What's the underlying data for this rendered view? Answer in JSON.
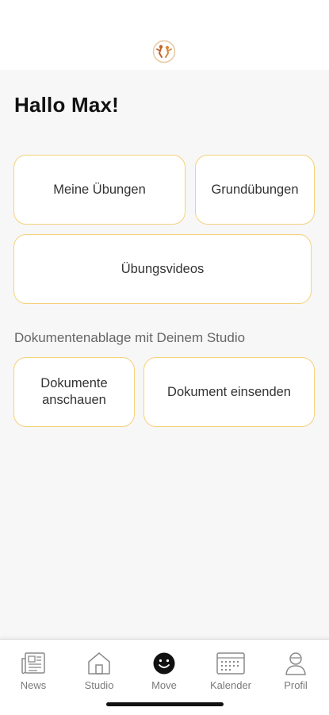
{
  "header": {
    "logo_icon": "fitness-logo-icon"
  },
  "greeting": "Hallo Max!",
  "tiles_top": [
    {
      "label": "Meine Übungen"
    },
    {
      "label": "Grundübungen"
    },
    {
      "label": "Übungsvideos"
    }
  ],
  "documents": {
    "section_label": "Dokumentenablage mit Deinem Studio",
    "tiles": [
      {
        "label": "Dokumente\nanschauen"
      },
      {
        "label": "Dokument einsenden"
      }
    ]
  },
  "tabbar": {
    "items": [
      {
        "label": "News",
        "icon": "newspaper-icon"
      },
      {
        "label": "Studio",
        "icon": "house-icon"
      },
      {
        "label": "Move",
        "icon": "smiley-icon",
        "active": true
      },
      {
        "label": "Kalender",
        "icon": "calendar-icon"
      },
      {
        "label": "Profil",
        "icon": "person-icon"
      }
    ]
  },
  "colors": {
    "tile_border": "#f4d27a",
    "background": "#f7f7f7",
    "accent_logo": "#c0622b"
  }
}
